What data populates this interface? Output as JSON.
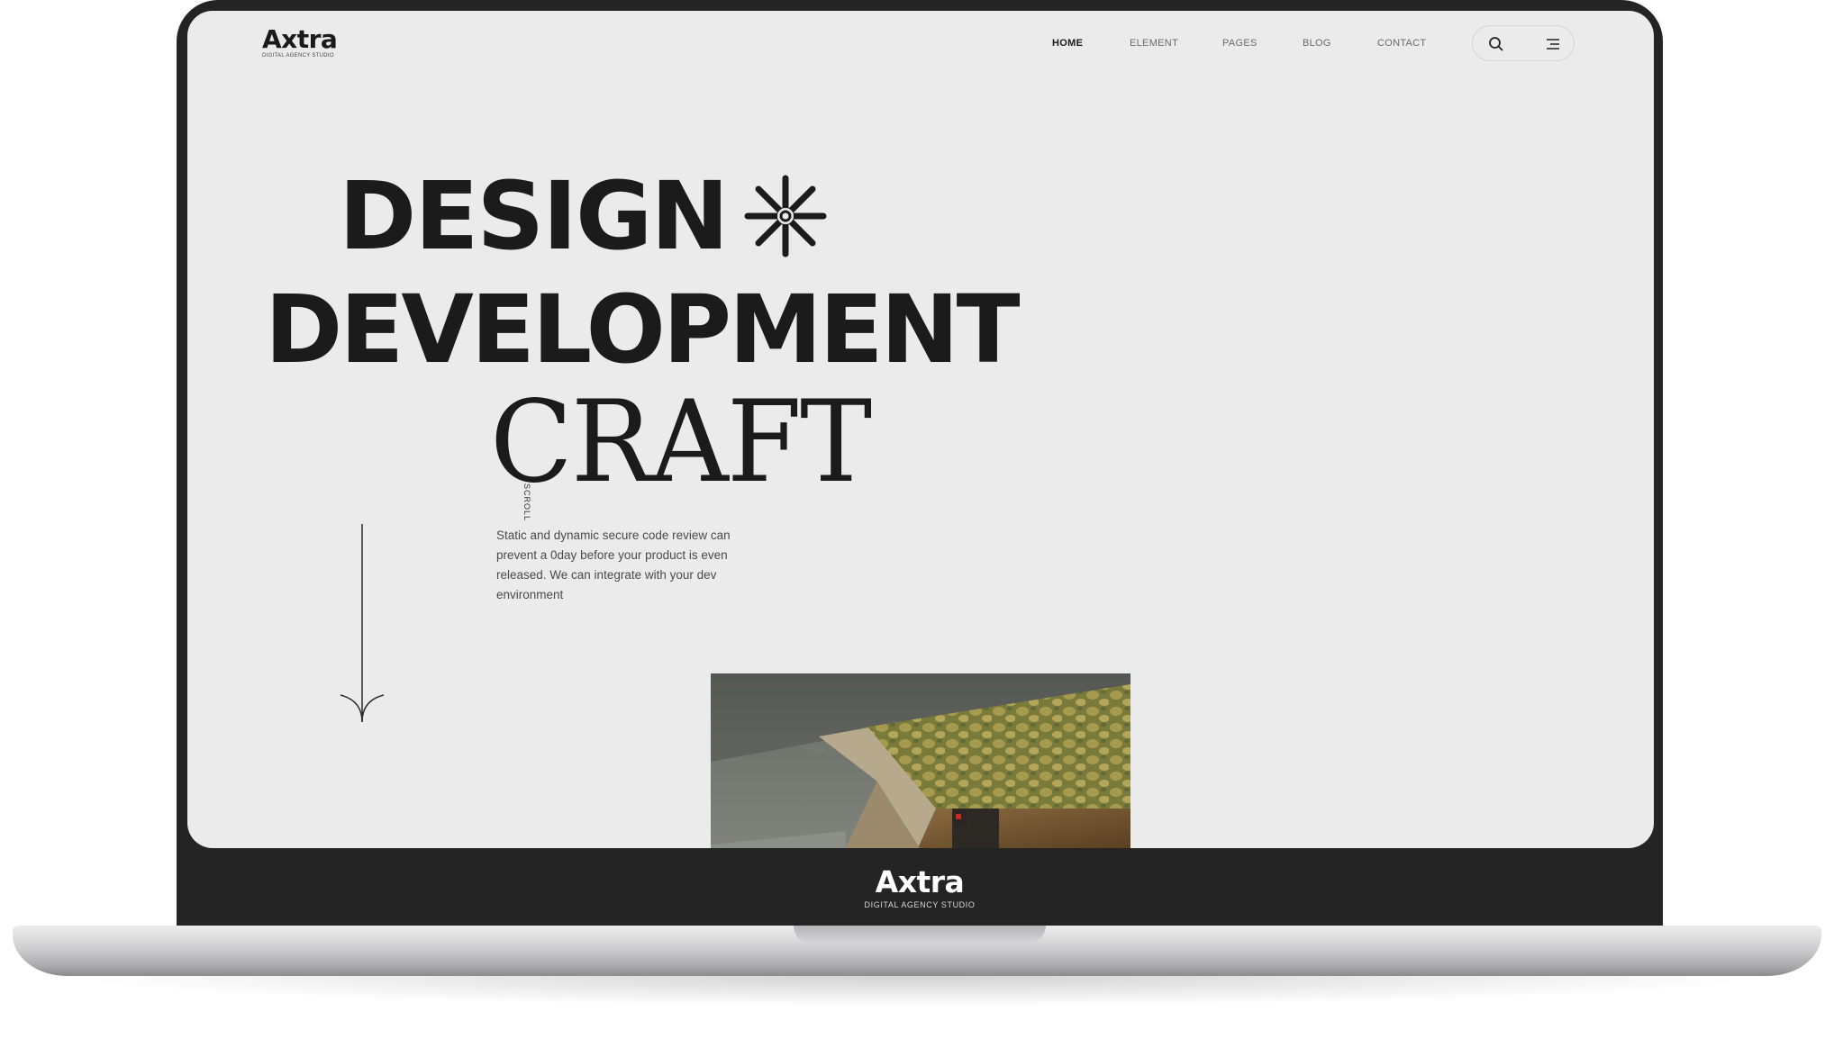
{
  "site": {
    "logo": "Axtra",
    "tagline": "DIGITAL AGENCY STUDIO"
  },
  "nav": {
    "items": [
      {
        "label": "HOME",
        "active": true
      },
      {
        "label": "ELEMENT",
        "active": false
      },
      {
        "label": "PAGES",
        "active": false
      },
      {
        "label": "BLOG",
        "active": false
      },
      {
        "label": "CONTACT",
        "active": false
      }
    ],
    "icons": [
      "search-icon",
      "menu-icon"
    ]
  },
  "hero": {
    "line1": "DESIGN",
    "line2": "DEVELOPMENT",
    "line3": "CRAFT",
    "scroll_label": "SCROLL",
    "description": "Static and dynamic secure code review can prevent a 0day before your product is even released. We can integrate with your dev environment"
  },
  "laptop": {
    "chin_logo": "Axtra",
    "chin_tagline": "DIGITAL AGENCY STUDIO"
  },
  "colors": {
    "screen_bg": "#ebebeb",
    "text_dark": "#1b1b1b",
    "frame": "#242424"
  }
}
